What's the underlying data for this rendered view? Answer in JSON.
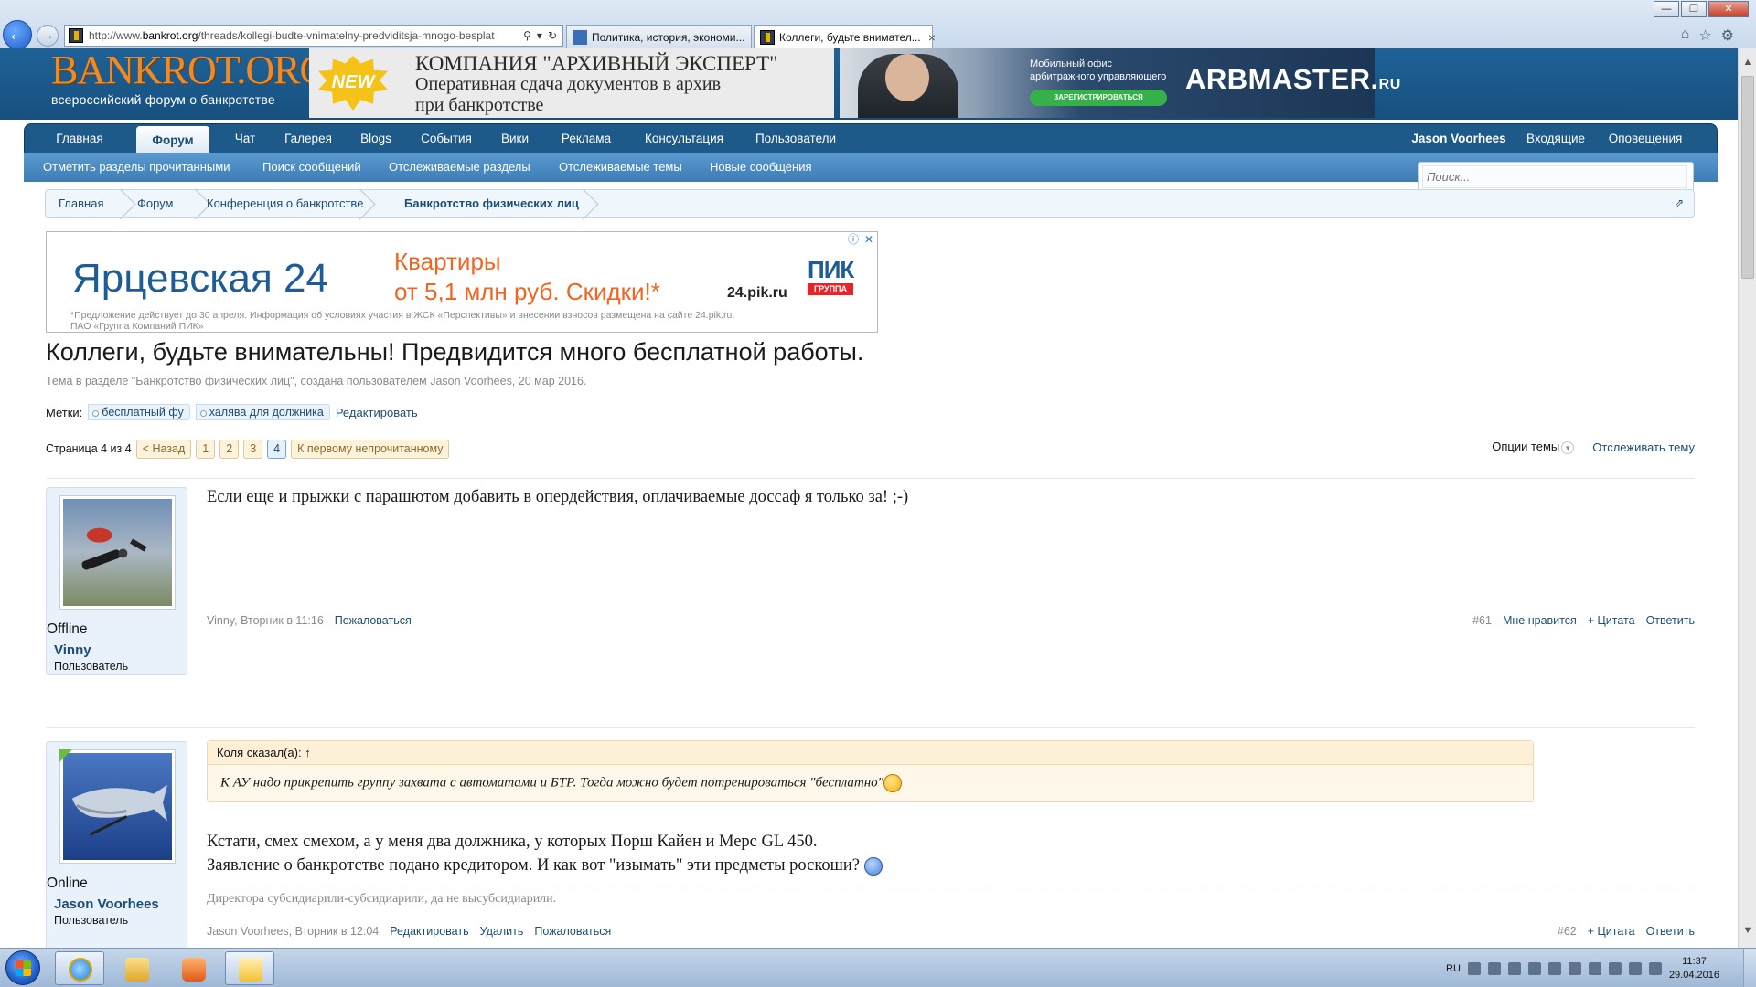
{
  "browser": {
    "url_prefix": "http://www.",
    "url_domain": "bankrot.org",
    "url_path": "/threads/kollegi-budte-vnimatelny-predviditsja-mnogo-besplat",
    "tabs": [
      {
        "label": "Политика, история, экономи..."
      },
      {
        "label": "Коллеги, будьте внимател..."
      }
    ],
    "tab_close": "×",
    "back_glyph": "←",
    "fwd_glyph": "→",
    "addr_search": "⚲",
    "addr_dropdown": "▾",
    "addr_refresh": "↻",
    "win_min": "—",
    "win_max": "❐",
    "win_close": "✕",
    "tool_home": "⌂",
    "tool_fav": "☆",
    "tool_gear": "⚙"
  },
  "site": {
    "logo_title": "BANKROT.ORG",
    "logo_subtitle": "всероссийский форум о банкротстве"
  },
  "banner1": {
    "badge": "NEW",
    "line1": "КОМПАНИЯ \"АРХИВНЫЙ ЭКСПЕРТ\"",
    "line2": "Оперативная сдача документов в архив",
    "line3": "при банкротстве"
  },
  "banner2": {
    "small1": "Мобильный офис",
    "small2": "арбитражного управляющего",
    "button": "ЗАРЕГИСТРИРОВАТЬСЯ",
    "brand": "ARBMASTER.",
    "brand_suffix": "RU"
  },
  "nav": {
    "tabs": [
      "Главная",
      "Форум",
      "Чат",
      "Галерея",
      "Blogs",
      "События",
      "Вики",
      "Реклама",
      "Консультация",
      "Пользователи"
    ],
    "active": "Форум",
    "user": "Jason Voorhees",
    "inbox": "Входящие",
    "alerts": "Оповещения"
  },
  "subnav": [
    "Отметить разделы прочитанными",
    "Поиск сообщений",
    "Отслеживаемые разделы",
    "Отслеживаемые темы",
    "Новые сообщения"
  ],
  "search": {
    "placeholder": "Поиск..."
  },
  "breadcrumbs": [
    "Главная",
    "Форум",
    "Конференция о банкротстве",
    "Банкротство физических лиц"
  ],
  "breadcrumb_jump": "⇗",
  "ad": {
    "title": "Ярцевская 24",
    "offer1": "Квартиры",
    "offer2": "от 5,1 млн руб. Скидки!*",
    "site": "24.pik.ru",
    "brand": "ПИК",
    "brand_sub": "ГРУППА",
    "legal1": "*Предложение действует до 30 апреля. Информация об условиях участия в ЖСК «Перспективы» и внесении взносов размещена на сайте 24.pik.ru.",
    "legal2": "ПАО «Группа Компаний ПИК»",
    "info": "ⓘ",
    "close": "✕"
  },
  "thread": {
    "title": "Коллеги, будьте внимательны! Предвидится много бесплатной работы.",
    "meta": "Тема в разделе \"Банкротство физических лиц\", создана пользователем Jason Voorhees, 20 мар 2016.",
    "tags_label": "Метки:",
    "tags": [
      "бесплатный фу",
      "халява для должника"
    ],
    "tags_edit": "Редактировать",
    "page_label": "Страница 4 из 4",
    "prev": "< Назад",
    "pages": [
      "1",
      "2",
      "3",
      "4"
    ],
    "current_page": "4",
    "first_unread": "К первому непрочитанному",
    "options": "Опции темы",
    "options_chev": "▾",
    "watch": "Отслеживать тему"
  },
  "posts": [
    {
      "status": "Offline",
      "username": "Vinny",
      "user_title": "Пользователь",
      "text": "Если еще и прыжки с парашютом добавить в опердействия, оплачиваемые доссаф я только за! ;-)",
      "author": "Vinny",
      "date": "Вторник в 11:16",
      "report": "Пожаловаться",
      "number": "#61",
      "like": "Мне нравится",
      "quote": "+ Цитата",
      "reply": "Ответить"
    },
    {
      "status": "Online",
      "username": "Jason Voorhees",
      "user_title": "Пользователь",
      "quote_header": "Коля сказал(а): ↑",
      "quote_text": "К АУ надо прикрепить группу захвата с автоматами и БТР. Тогда можно будет потренироваться \"бесплатно\"",
      "line1": "Кстати, смех смехом, а у меня два должника, у которых Порш Кайен и Мерс GL 450.",
      "line2": "Заявление о банкротстве подано кредитором. И как вот \"изымать\" эти предметы роскоши?",
      "signature": "Директора субсидиарили-субсидиарили, да не высубсидиарили.",
      "author": "Jason Voorhees",
      "date": "Вторник в 12:04",
      "edit": "Редактировать",
      "delete": "Удалить",
      "report": "Пожаловаться",
      "number": "#62",
      "quote": "+ Цитата",
      "reply": "Ответить"
    }
  ],
  "taskbar": {
    "lang": "RU",
    "time": "11:37",
    "date": "29.04.2016"
  },
  "scroll_up": "▲",
  "scroll_down": "▼"
}
